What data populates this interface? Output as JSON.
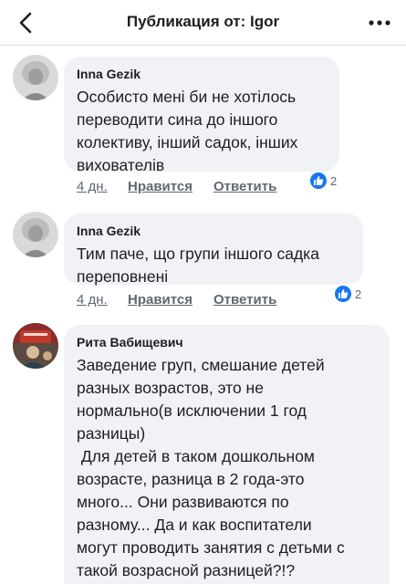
{
  "header": {
    "title": "Публикация от: Igor"
  },
  "colors": {
    "accent": "#1877f2",
    "bubble": "#f0f2f5",
    "secondary_text": "#606770"
  },
  "comments": [
    {
      "author": "Inna Gezik",
      "text": "Особисто мені би не хотілось\nпереводити сина до іншого\nколективу, інший садок, інших\nвихователів",
      "time": "4 дн.",
      "like_label": "Нравится",
      "reply_label": "Ответить",
      "reaction_icon": "like-icon",
      "reaction_count": "2"
    },
    {
      "author": "Inna Gezik",
      "text": "Тим паче, що групи іншого садка\nпереповнені",
      "time": "4 дн.",
      "like_label": "Нравится",
      "reply_label": "Ответить",
      "reaction_icon": "like-icon",
      "reaction_count": "2"
    },
    {
      "author": "Рита Вабищевич",
      "text": "Заведение груп, смешание детей\nразных возрастов, это не\nнормально(в исключении 1 год\nразницы)\n Для детей в таком дошкольном\nвозрасте, разница в 2 года-это\nмного... Они развиваются по\nразному... Да и как воспитатели\nмогут проводить занятия с детьми с\nтакой возрасной разницей?!?"
    }
  ]
}
